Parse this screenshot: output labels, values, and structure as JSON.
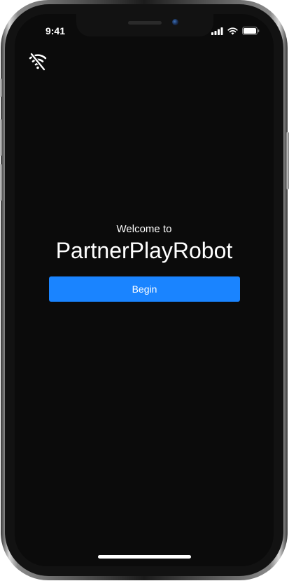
{
  "status_bar": {
    "time": "9:41",
    "icons": [
      "cellular-signal-icon",
      "wifi-icon",
      "battery-icon"
    ]
  },
  "toolbar": {
    "connection_icon": "wifi-off-icon"
  },
  "welcome": {
    "subtitle": "Welcome to",
    "title": "PartnerPlayRobot"
  },
  "begin_button": {
    "label": "Begin"
  },
  "colors": {
    "screen_background": "#0b0b0b",
    "accent": "#1a84ff",
    "text": "#ffffff"
  }
}
